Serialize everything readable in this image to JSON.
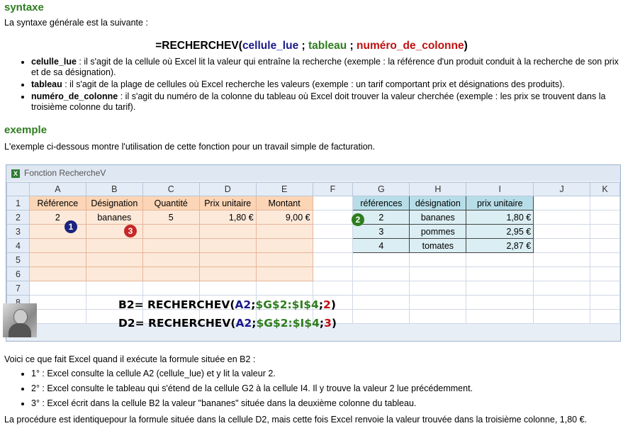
{
  "section1": {
    "title": "syntaxe",
    "intro": "La syntaxe générale est la suivante :",
    "syntax": {
      "prefix": "=RECHERCHEV(",
      "arg1": "cellule_lue",
      "sep1": " ; ",
      "arg2": "tableau",
      "sep2": " ; ",
      "arg3": "numéro_de_colonne",
      "suffix": ")"
    },
    "bullets": [
      {
        "term": "celulle_lue",
        "text": " : il s'agit de la cellule où Excel lit la valeur qui entraîne la recherche (exemple : la référence d'un produit conduit à la recherche de son prix et de sa désignation)."
      },
      {
        "term": "tableau",
        "text": " : il s'agit de la plage de cellules où Excel recherche les valeurs (exemple : un tarif comportant prix et désignations des produits)."
      },
      {
        "term": "numéro_de_colonne",
        "text": " : il s'agit du numéro de la colonne du tableau où Excel doit trouver la valeur cherchée (exemple : les prix se trouvent dans la troisième colonne du tarif)."
      }
    ]
  },
  "section2": {
    "title": "exemple",
    "intro": "L'exemple ci-dessous montre l'utilisation de cette fonction pour un travail simple de facturation."
  },
  "spreadsheet": {
    "window_title": "Fonction RechercheV",
    "columns": [
      "A",
      "B",
      "C",
      "D",
      "E",
      "F",
      "G",
      "H",
      "I",
      "J",
      "K"
    ],
    "rows": [
      "1",
      "2",
      "3",
      "4",
      "5",
      "6",
      "7",
      "8",
      "9"
    ],
    "left_headers": [
      "Référence",
      "Désignation",
      "Quantité",
      "Prix unitaire",
      "Montant"
    ],
    "left_row2": [
      "2",
      "bananes",
      "5",
      "1,80 €",
      "9,00 €"
    ],
    "right_headers": [
      "références",
      "désignation",
      "prix unitaire"
    ],
    "right_rows": [
      [
        "2",
        "bananes",
        "1,80 €"
      ],
      [
        "3",
        "pommes",
        "2,95 €"
      ],
      [
        "4",
        "tomates",
        "2,87 €"
      ]
    ],
    "badges": [
      "1",
      "2",
      "3"
    ],
    "formula1": {
      "label": "B2=",
      "fn": "RECHERCHEV(",
      "a": "A2",
      "s1": ";",
      "b": "$G$2:$I$4",
      "s2": ";",
      "c": "2",
      "end": ")"
    },
    "formula2": {
      "label": "D2=",
      "fn": "RECHERCHEV(",
      "a": "A2",
      "s1": ";",
      "b": "$G$2:$I$4",
      "s2": ";",
      "c": "3",
      "end": ")"
    }
  },
  "section3": {
    "intro": "Voici ce que fait Excel quand il exécute la formule située en B2 :",
    "steps": [
      "1° : Excel consulte la cellule A2 (cellule_lue) et y lit la valeur 2.",
      "2° : Excel consulte le tableau qui s'étend de la cellule G2 à la cellule I4. Il y trouve la valeur 2 lue précédemment.",
      "3° : Excel écrit dans la cellule B2 la valeur \"bananes\" située dans la deuxième colonne du tableau."
    ],
    "conclusion": "La procédure est identiquepour la formule située dans la cellule D2, mais cette fois Excel renvoie la valeur trouvée dans la troisième colonne, 1,80 €."
  },
  "colors": {
    "heading": "#2e7d1f",
    "arg1": "#1a1a8c",
    "arg2": "#2e7d1f",
    "arg3": "#c01010",
    "badge1": "#1a237e",
    "badge2": "#2e7d1f",
    "badge3": "#c62828"
  }
}
